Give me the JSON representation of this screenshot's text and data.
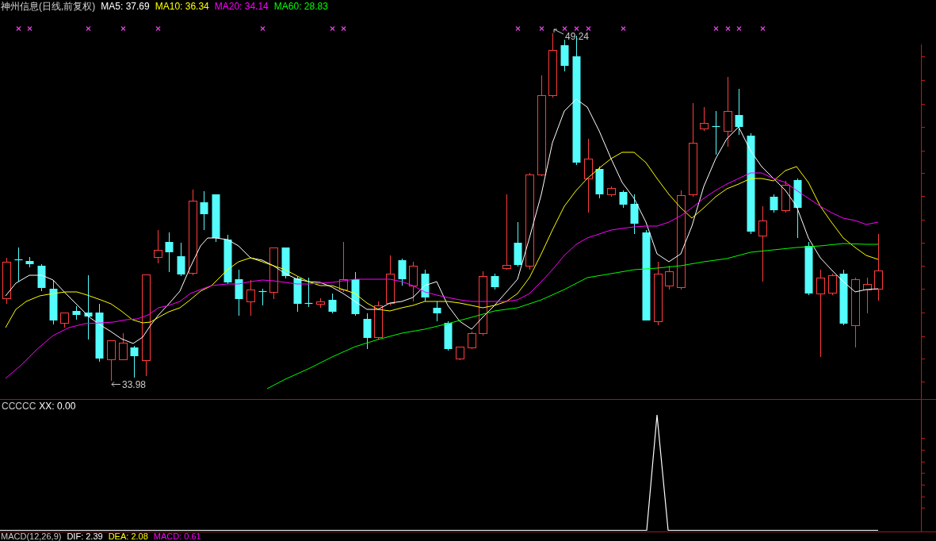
{
  "header": {
    "title": "神州信息(日线,前复权)",
    "indicators": [
      {
        "label": "MA5: 37.69",
        "color": "#ffffff"
      },
      {
        "label": "MA10: 36.34",
        "color": "#ffff00"
      },
      {
        "label": "MA20: 34.14",
        "color": "#ff00ff"
      },
      {
        "label": "MA60: 28.83",
        "color": "#00ff00"
      }
    ]
  },
  "price_chart": {
    "high_label": "49.24",
    "low_label": "33.98"
  },
  "indicator_panel": {
    "title": "CCCCC",
    "values": [
      {
        "label": "XX: 0.00",
        "color": "#ffffff"
      }
    ]
  },
  "macd_legend": {
    "title": "MACD(12,26,9)",
    "values": [
      {
        "label": "DIF: 2.39",
        "color": "#ffffff"
      },
      {
        "label": "DEA: 2.08",
        "color": "#ffff00"
      },
      {
        "label": "MACD: 0.61",
        "color": "#ff00ff"
      }
    ]
  }
}
